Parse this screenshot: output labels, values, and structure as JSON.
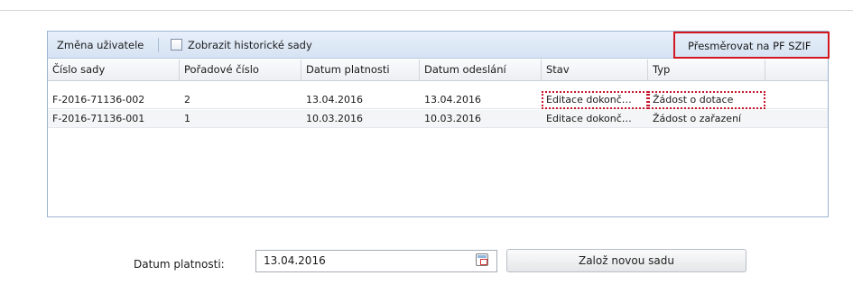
{
  "toolbar": {
    "change_user_label": "Změna uživatele",
    "show_history_label": "Zobrazit historické sady",
    "show_history_checked": false,
    "redirect_label": "Přesměrovat na PF SZIF"
  },
  "grid": {
    "columns": [
      "Číslo sady",
      "Pořadové číslo",
      "Datum platnosti",
      "Datum odeslání",
      "Stav",
      "Typ"
    ],
    "rows": [
      [
        "F-2016-71136-002",
        "2",
        "13.04.2016",
        "13.04.2016",
        "Editace dokonč…",
        "Žádost o dotace"
      ],
      [
        "F-2016-71136-001",
        "1",
        "10.03.2016",
        "10.03.2016",
        "Editace dokonč…",
        "Žádost o zařazení"
      ]
    ]
  },
  "form": {
    "date_label": "Datum platnosti:",
    "date_value": "13.04.2016",
    "new_set_button": "Založ novou sadu"
  },
  "colors": {
    "highlight_red": "#d2171f",
    "toolbar_blue": "#d6e3f3",
    "panel_border": "#9bb5d4"
  }
}
